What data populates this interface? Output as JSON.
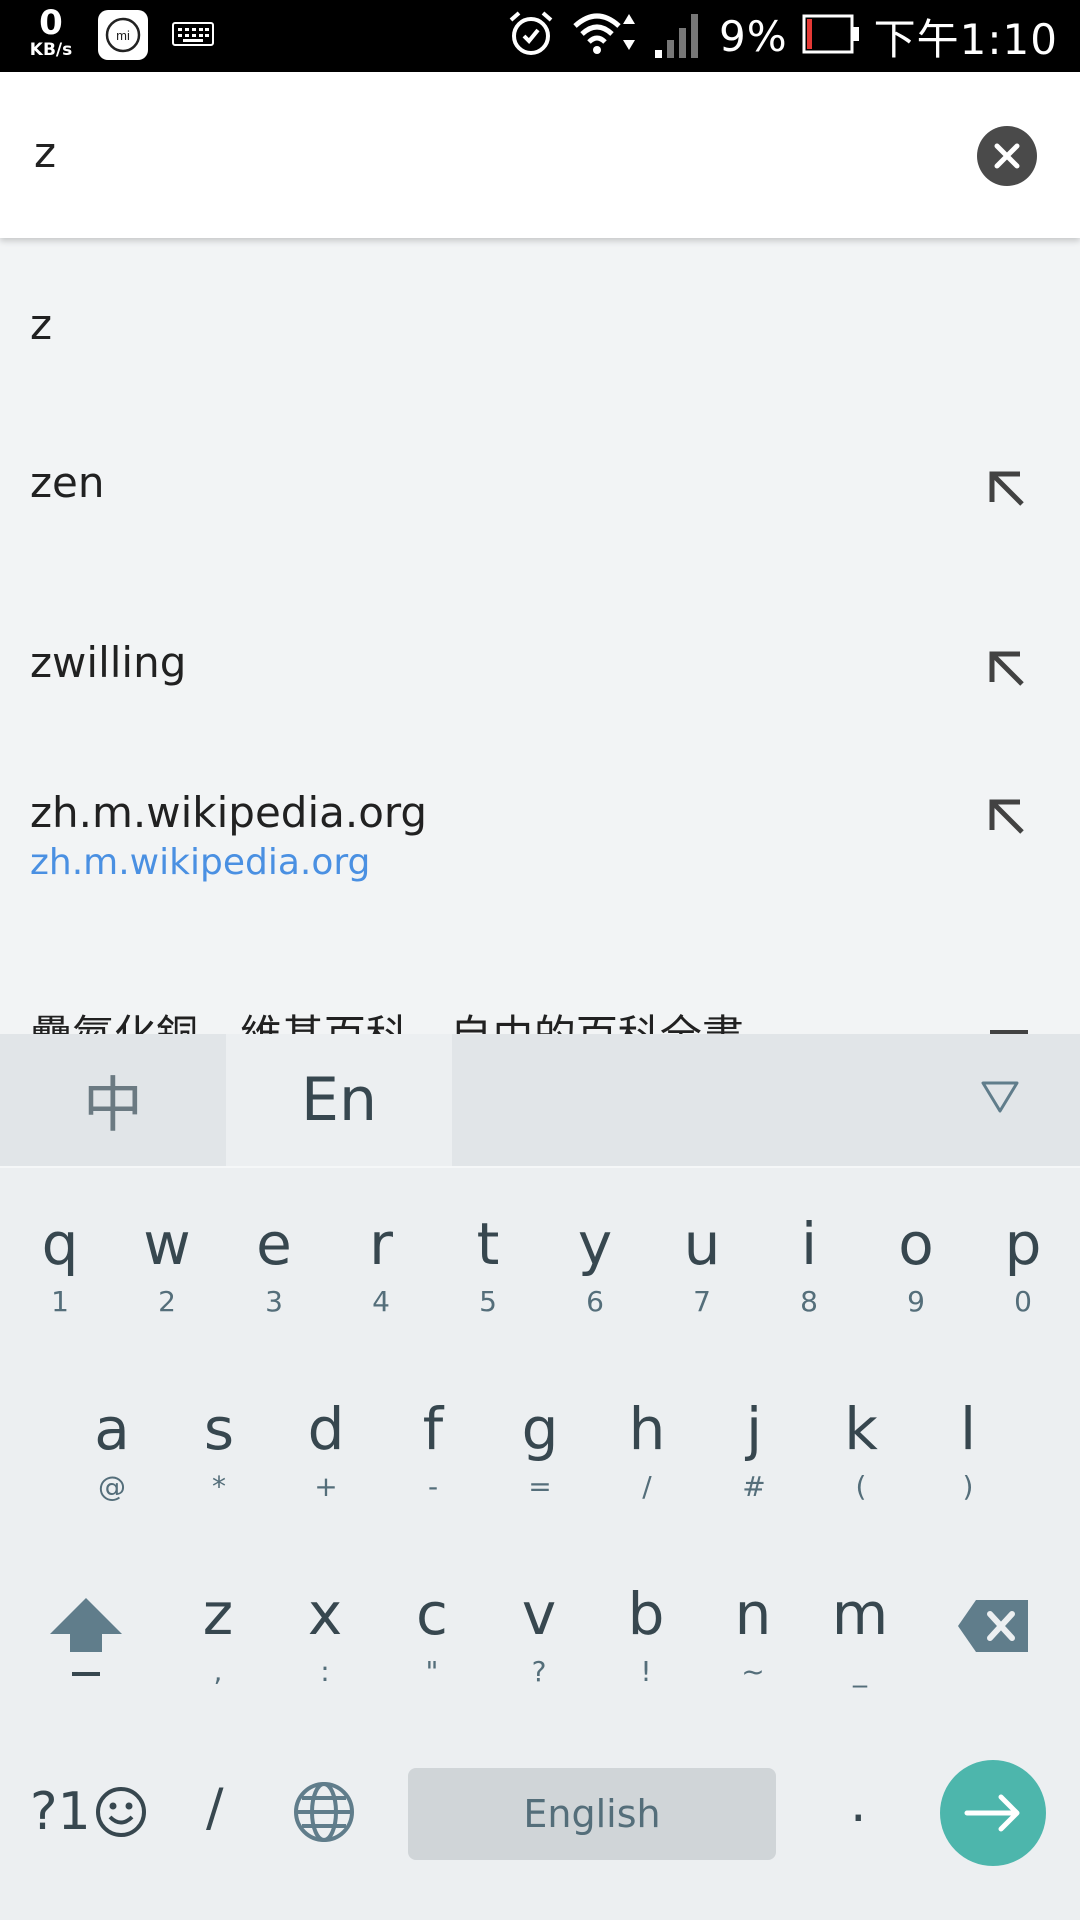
{
  "status_bar": {
    "net_speed_value": "0",
    "net_speed_unit": "KB/s",
    "mi_icon_text": "mi",
    "battery_text": "9%",
    "time": "下午1:10",
    "battery_color": "#e53935"
  },
  "search": {
    "query": "z"
  },
  "suggestions": [
    {
      "text": "z"
    },
    {
      "text": "zen"
    },
    {
      "text": "zwilling"
    },
    {
      "text": "zh.m.wikipedia.org",
      "url": "zh.m.wikipedia.org"
    },
    {
      "text": "疊氮化銅 - 維基百科，自由的百科全書"
    }
  ],
  "keyboard": {
    "lang_zh": "中",
    "lang_en": "En",
    "row1": [
      {
        "m": "q",
        "s": "1"
      },
      {
        "m": "w",
        "s": "2"
      },
      {
        "m": "e",
        "s": "3"
      },
      {
        "m": "r",
        "s": "4"
      },
      {
        "m": "t",
        "s": "5"
      },
      {
        "m": "y",
        "s": "6"
      },
      {
        "m": "u",
        "s": "7"
      },
      {
        "m": "i",
        "s": "8"
      },
      {
        "m": "o",
        "s": "9"
      },
      {
        "m": "p",
        "s": "0"
      }
    ],
    "row2": [
      {
        "m": "a",
        "s": "@"
      },
      {
        "m": "s",
        "s": "*"
      },
      {
        "m": "d",
        "s": "+"
      },
      {
        "m": "f",
        "s": "-"
      },
      {
        "m": "g",
        "s": "="
      },
      {
        "m": "h",
        "s": "/"
      },
      {
        "m": "j",
        "s": "#"
      },
      {
        "m": "k",
        "s": "("
      },
      {
        "m": "l",
        "s": ")"
      }
    ],
    "row3": [
      {
        "m": "z",
        "s": ","
      },
      {
        "m": "x",
        "s": ":"
      },
      {
        "m": "c",
        "s": "\""
      },
      {
        "m": "v",
        "s": "?"
      },
      {
        "m": "b",
        "s": "!"
      },
      {
        "m": "n",
        "s": "~"
      },
      {
        "m": "m",
        "s": "_"
      }
    ],
    "symbols_label": "?1",
    "slash_label": "/",
    "space_label": "English",
    "period_label": ".",
    "accent_color": "#4db6ac"
  }
}
